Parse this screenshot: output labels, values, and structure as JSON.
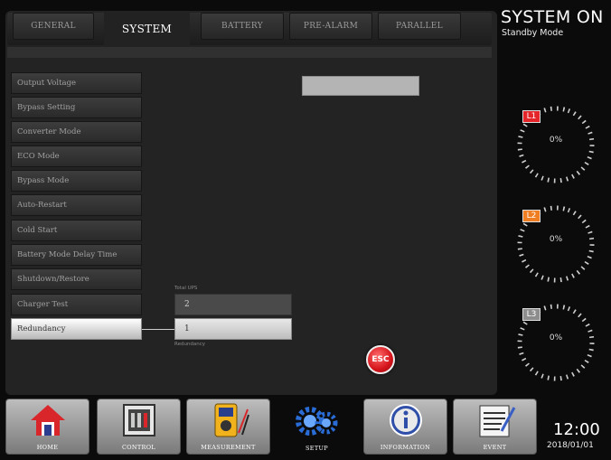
{
  "tabs": [
    {
      "label": "GENERAL"
    },
    {
      "label": "SYSTEM"
    },
    {
      "label": "BATTERY"
    },
    {
      "label": "PRE-ALARM"
    },
    {
      "label": "PARALLEL"
    }
  ],
  "active_tab": "SYSTEM",
  "menu": [
    {
      "label": "Output Voltage"
    },
    {
      "label": "Bypass Setting"
    },
    {
      "label": "Converter Mode"
    },
    {
      "label": "ECO Mode"
    },
    {
      "label": "Bypass Mode"
    },
    {
      "label": "Auto-Restart"
    },
    {
      "label": "Cold Start"
    },
    {
      "label": "Battery Mode Delay Time"
    },
    {
      "label": "Shutdown/Restore"
    },
    {
      "label": "Charger Test"
    },
    {
      "label": "Redundancy"
    }
  ],
  "selected_menu": "Redundancy",
  "redundancy": {
    "total_label": "Total UPS",
    "total_value": "2",
    "redundancy_value": "1",
    "redundancy_label": "Redundancy"
  },
  "esc_label": "ESC",
  "status": {
    "title": "SYSTEM ON",
    "mode": "Standby Mode"
  },
  "gauges": [
    {
      "label": "L1",
      "value": "0%",
      "color": "#e4262b"
    },
    {
      "label": "L2",
      "value": "0%",
      "color": "#ef7d22"
    },
    {
      "label": "L3",
      "value": "0%",
      "color": "#8d8d8d"
    }
  ],
  "nav": [
    {
      "label": "HOME",
      "icon": "home-icon"
    },
    {
      "label": "CONTROL",
      "icon": "control-icon"
    },
    {
      "label": "MEASUREMENT",
      "icon": "multimeter-icon"
    },
    {
      "label": "SETUP",
      "icon": "gears-icon"
    },
    {
      "label": "INFORMATION",
      "icon": "info-icon"
    },
    {
      "label": "EVENT",
      "icon": "event-log-icon"
    }
  ],
  "clock": {
    "time": "12:00",
    "date": "2018/01/01"
  }
}
